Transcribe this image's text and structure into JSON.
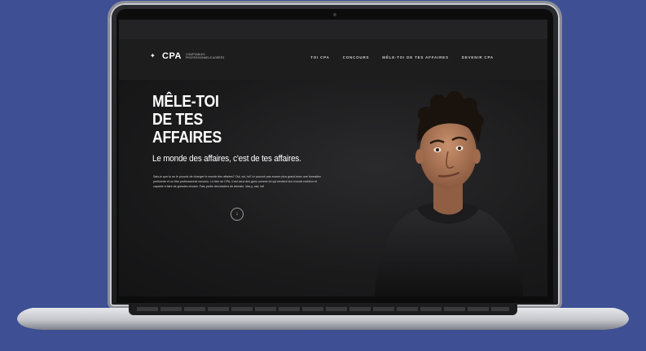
{
  "site": {
    "brand": "CPA",
    "brand_sub": "Comptables professionnels agréés",
    "nav": [
      "Toi CPA",
      "Concours",
      "Mêle-toi de tes affaires",
      "Devenir CPA"
    ],
    "headline": [
      "MÊLE-TOI",
      "DE TES",
      "AFFAIRES"
    ],
    "subhead": "Le monde des affaires, c'est de tes affaires.",
    "body": "Sais-tu que tu as le pouvoir de changer le monde des affaires? Oui, oui, toi! Le pouvoir pas encore plus grand avec une formation pertinente et un titre professionnel reconnu. Le titre de CPA, c'est ceux des gens comme toi qui rendent leur monde meilleur et capable à faire de grandes choses. Fais partie des leaders de demain. Vas-y, ose, toi!",
    "scroll_icon": "arrow-down-icon"
  },
  "colors": {
    "background": "#3e4f94",
    "screen": "#181818",
    "text": "#ffffff"
  }
}
